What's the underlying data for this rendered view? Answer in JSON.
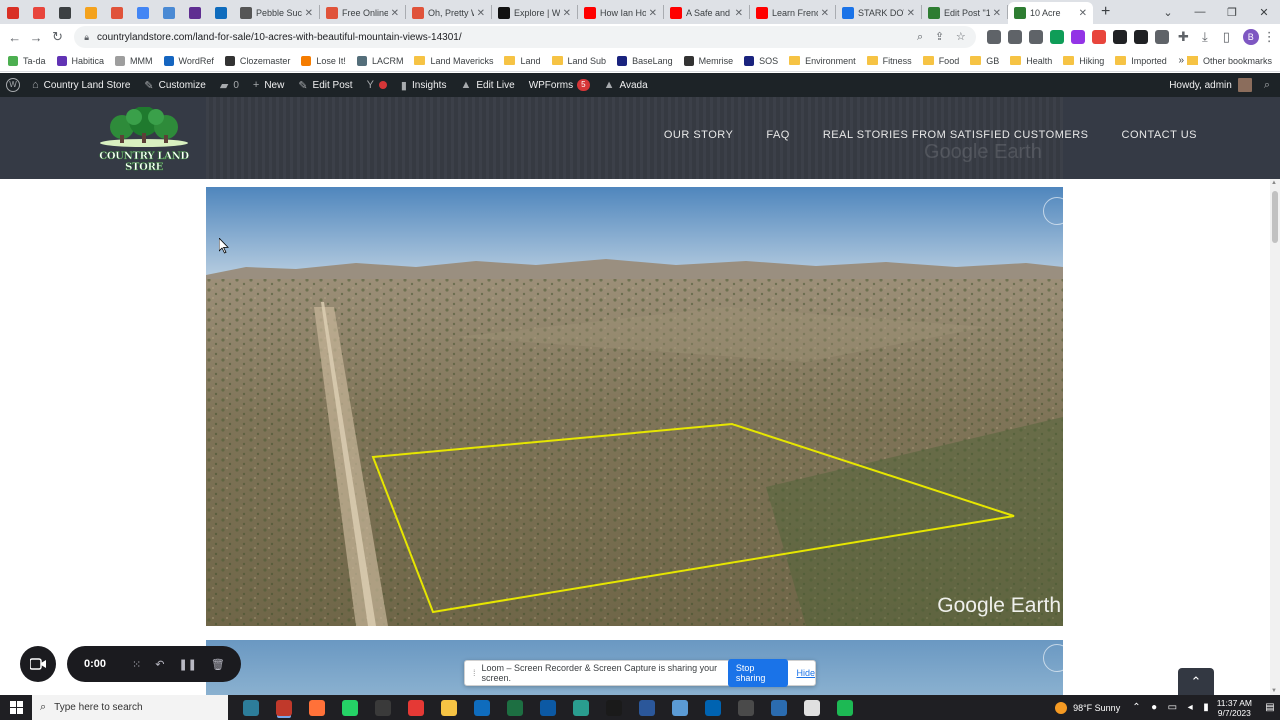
{
  "browser": {
    "tabs": [
      {
        "label": "",
        "pinned": true,
        "color": "#d93025"
      },
      {
        "label": "",
        "pinned": true,
        "color": "#e8453c"
      },
      {
        "label": "",
        "pinned": true,
        "color": "#3c4043"
      },
      {
        "label": "",
        "pinned": true,
        "color": "#f4a21d"
      },
      {
        "label": "",
        "pinned": true,
        "color": "#e0533a"
      },
      {
        "label": "",
        "pinned": true,
        "color": "#4285f4"
      },
      {
        "label": "",
        "pinned": true,
        "color": "#4a8ad4"
      },
      {
        "label": "",
        "pinned": true,
        "color": "#5f2e91"
      },
      {
        "label": "",
        "pinned": true,
        "color": "#0f6cbd"
      },
      {
        "label": "Pebble Succ",
        "pinned": false,
        "color": "#555555"
      },
      {
        "label": "Free Online",
        "pinned": false,
        "color": "#e0533a"
      },
      {
        "label": "Oh, Pretty W",
        "pinned": false,
        "color": "#e0533a"
      },
      {
        "label": "Explore | W",
        "pinned": false,
        "color": "#111111"
      },
      {
        "label": "How Ian Ho",
        "pinned": false,
        "color": "#ff0000"
      },
      {
        "label": "A Safe and",
        "pinned": false,
        "color": "#ff0000"
      },
      {
        "label": "Learn Frenc",
        "pinned": false,
        "color": "#ff0000"
      },
      {
        "label": "STARK DOV",
        "pinned": false,
        "color": "#1a73e8"
      },
      {
        "label": "Edit Post \"1",
        "pinned": false,
        "color": "#2e7d32"
      },
      {
        "label": "10 Acre",
        "pinned": false,
        "color": "#2e7d32",
        "active": true
      }
    ],
    "new_tab": "+",
    "url": "countrylandstore.com/land-for-sale/10-acres-with-beautiful-mountain-views-14301/",
    "profile_initial": "B",
    "extension_colors": [
      "#5f6368",
      "#5f6368",
      "#5f6368",
      "#0f9d58",
      "#9334e6",
      "#e8453c",
      "#202124",
      "#202124",
      "#5f6368"
    ]
  },
  "bookmarks": {
    "items": [
      {
        "label": "Ta-da",
        "type": "site",
        "color": "#4caf50"
      },
      {
        "label": "Habitica",
        "type": "site",
        "color": "#6133b4"
      },
      {
        "label": "MMM",
        "type": "site",
        "color": "#9e9e9e"
      },
      {
        "label": "WordRef",
        "type": "site",
        "color": "#1565c0"
      },
      {
        "label": "Clozemaster",
        "type": "site",
        "color": "#333333"
      },
      {
        "label": "Lose It!",
        "type": "site",
        "color": "#f57c00"
      },
      {
        "label": "LACRM",
        "type": "site",
        "color": "#546e7a"
      },
      {
        "label": "Land Mavericks",
        "type": "folder"
      },
      {
        "label": "Land",
        "type": "folder"
      },
      {
        "label": "Land Sub",
        "type": "folder"
      },
      {
        "label": "BaseLang",
        "type": "site",
        "color": "#1a237e"
      },
      {
        "label": "Memrise",
        "type": "site",
        "color": "#333333"
      },
      {
        "label": "SOS",
        "type": "site",
        "color": "#1a237e"
      },
      {
        "label": "Environment",
        "type": "folder"
      },
      {
        "label": "Fitness",
        "type": "folder"
      },
      {
        "label": "Food",
        "type": "folder"
      },
      {
        "label": "GB",
        "type": "folder"
      },
      {
        "label": "Health",
        "type": "folder"
      },
      {
        "label": "Hiking",
        "type": "folder"
      },
      {
        "label": "Imported",
        "type": "folder"
      }
    ],
    "more": "»",
    "other": "Other bookmarks"
  },
  "wp_admin": {
    "site_name": "Country Land Store",
    "customize": "Customize",
    "comments_count": "0",
    "new": "New",
    "edit_post": "Edit Post",
    "insights": "Insights",
    "edit_live": "Edit Live",
    "wpforms": "WPForms",
    "wpforms_badge": "5",
    "avada": "Avada",
    "howdy": "Howdy, admin"
  },
  "site": {
    "logo_text": "COUNTRY LAND STORE",
    "nav": [
      "OUR STORY",
      "FAQ",
      "REAL STORIES FROM SATISFIED CUSTOMERS",
      "CONTACT US"
    ],
    "header_watermark": "Google Earth",
    "image_watermark": "Google Earth"
  },
  "loom": {
    "timer": "0:00",
    "banner_text": "Loom – Screen Recorder & Screen Capture is sharing your screen.",
    "stop_label": "Stop sharing",
    "hide_label": "Hide"
  },
  "taskbar": {
    "search_placeholder": "Type here to search",
    "app_colors": [
      "#2d7d9a",
      "#c0392b",
      "#ff7139",
      "#25d366",
      "#3a3a3a",
      "#e53935",
      "#f6c344",
      "#0f6cbd",
      "#1d6f42",
      "#0c59a4",
      "#2a9d8f",
      "#1a1a1a",
      "#2b579a",
      "#5b9bd5",
      "#0063b1",
      "#4a4a4a",
      "#2b6cb0",
      "#e0e0e0",
      "#1db954"
    ],
    "active_app_index": 1,
    "weather": "98°F  Sunny",
    "time": "11:37 AM",
    "date": "9/7/2023"
  },
  "colors": {
    "admin_bar": "#1d2327",
    "header": "#353a45",
    "parcel_outline": "#e6e600",
    "loom_primary": "#1a73e8"
  }
}
